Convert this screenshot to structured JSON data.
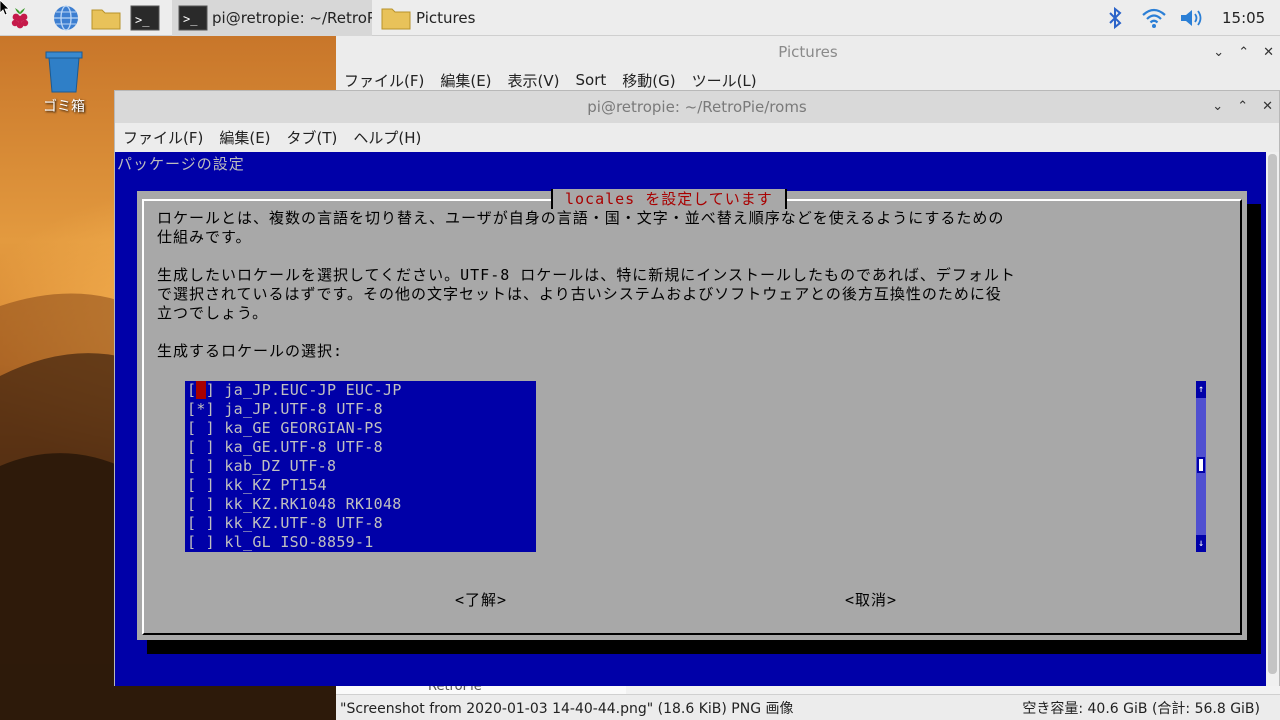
{
  "taskbar": {
    "tasks": [
      {
        "label": "pi@retropie: ~/RetroP..."
      },
      {
        "label": "Pictures"
      }
    ],
    "clock": "15:05"
  },
  "desktop": {
    "trash_label": "ゴミ箱"
  },
  "pictures_window": {
    "title": "Pictures",
    "menu": [
      "ファイル(F)",
      "編集(E)",
      "表示(V)",
      "Sort",
      "移動(G)",
      "ツール(L)"
    ],
    "tree_stub": "RetroPie",
    "status_file": "\"Screenshot from 2020-01-03 14-40-44.png\" (18.6 KiB) PNG 画像",
    "status_free": "空き容量: 40.6 GiB (合計: 56.8 GiB)"
  },
  "terminal_window": {
    "title": "pi@retropie: ~/RetroPie/roms",
    "menu": [
      "ファイル(F)",
      "編集(E)",
      "タブ(T)",
      "ヘルプ(H)"
    ]
  },
  "debconf": {
    "package_title": "パッケージの設定",
    "dialog_title": "locales を設定しています",
    "desc_line1": "ロケールとは、複数の言語を切り替え、ユーザが自身の言語・国・文字・並べ替え順序などを使えるようにするための",
    "desc_line2": "仕組みです。",
    "desc_line3": "生成したいロケールを選択してください。UTF-8 ロケールは、特に新規にインストールしたものであれば、デフォルト",
    "desc_line4": "で選択されているはずです。その他の文字セットは、より古いシステムおよびソフトウェアとの後方互換性のために役",
    "desc_line5": "立つでしょう。",
    "prompt": "生成するロケールの選択:",
    "locales": [
      {
        "mark": "[ ]",
        "name": "ja_JP.EUC-JP EUC-JP",
        "checked": false,
        "cursor": true
      },
      {
        "mark": "[*]",
        "name": "ja_JP.UTF-8 UTF-8",
        "checked": true
      },
      {
        "mark": "[ ]",
        "name": "ka_GE GEORGIAN-PS",
        "checked": false
      },
      {
        "mark": "[ ]",
        "name": "ka_GE.UTF-8 UTF-8",
        "checked": false
      },
      {
        "mark": "[ ]",
        "name": "kab_DZ UTF-8",
        "checked": false
      },
      {
        "mark": "[ ]",
        "name": "kk_KZ PT154",
        "checked": false
      },
      {
        "mark": "[ ]",
        "name": "kk_KZ.RK1048 RK1048",
        "checked": false
      },
      {
        "mark": "[ ]",
        "name": "kk_KZ.UTF-8 UTF-8",
        "checked": false
      },
      {
        "mark": "[ ]",
        "name": "kl_GL ISO-8859-1",
        "checked": false
      }
    ],
    "ok_button": "<了解>",
    "cancel_button": "<取消>",
    "scroll_up": "↑",
    "scroll_down": "↓"
  },
  "colors": {
    "terminal_bg": "#0000a8",
    "dialog_bg": "#a8a8a8",
    "dialog_title": "#a80000"
  }
}
